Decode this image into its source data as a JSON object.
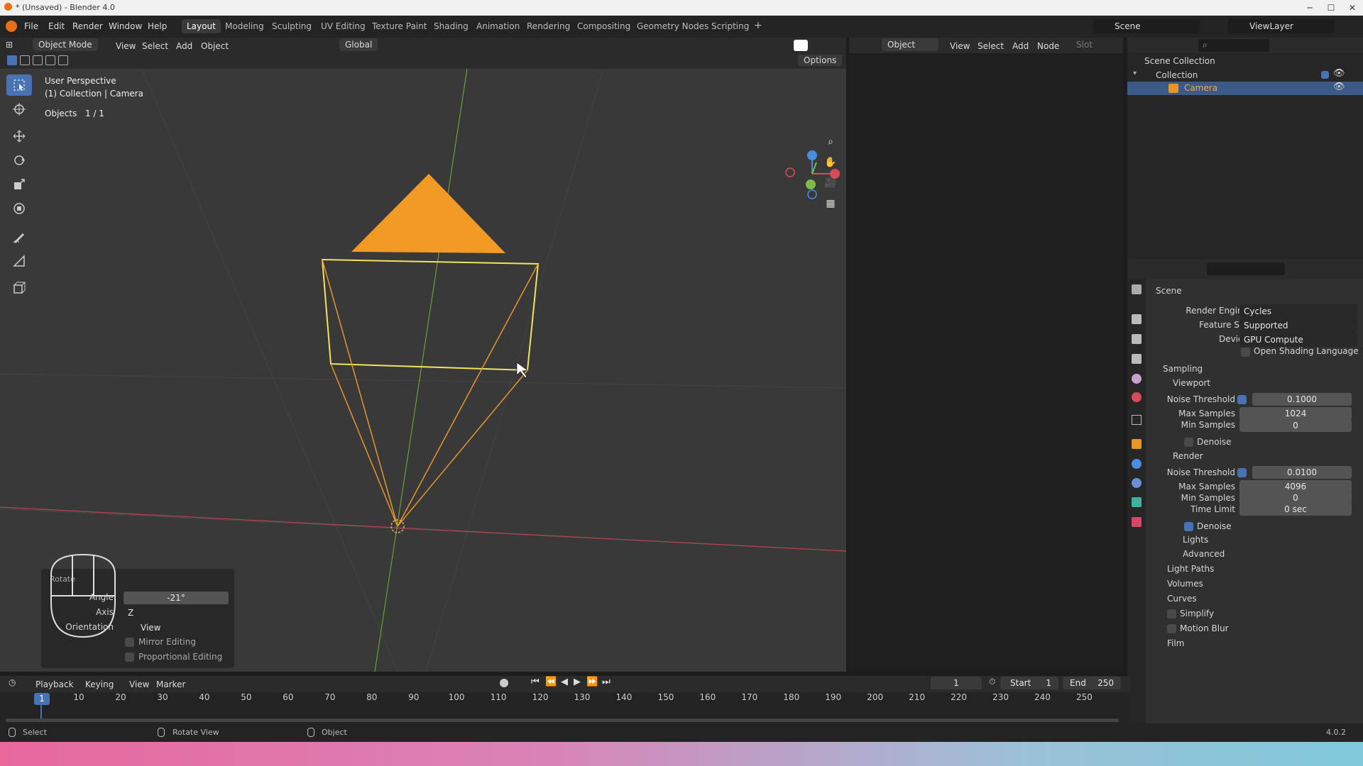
{
  "window": {
    "title": "* (Unsaved) - Blender 4.0"
  },
  "menus": [
    "File",
    "Edit",
    "Render",
    "Window",
    "Help"
  ],
  "workspaces": [
    "Layout",
    "Modeling",
    "Sculpting",
    "UV Editing",
    "Texture Paint",
    "Shading",
    "Animation",
    "Rendering",
    "Compositing",
    "Geometry Nodes",
    "Scripting"
  ],
  "active_workspace": "Layout",
  "scene": {
    "name": "Scene",
    "view_layer": "ViewLayer"
  },
  "viewport": {
    "mode": "Object Mode",
    "menus": [
      "View",
      "Select",
      "Add",
      "Object"
    ],
    "transform": "Global",
    "options": "Options",
    "overlay_title": "User Perspective",
    "overlay_collection": "(1) Collection | Camera",
    "objects_label": "Objects",
    "objects_count": "1 / 1",
    "colors": {
      "bg": "#393939",
      "camera_frame": "#f2e45a",
      "camera_lines": "#e8952a",
      "triangle": "#f19a25",
      "x_axis": "#b8434f",
      "y_axis": "#6f9e3a"
    }
  },
  "rotate_panel": {
    "title": "Rotate",
    "angle_label": "Angle",
    "angle_value": "-21°",
    "axis_label": "Axis",
    "axis_value": "Z",
    "orientation_label": "Orientation",
    "orientation_value": "View",
    "mirror": "Mirror Editing",
    "proportional": "Proportional Editing"
  },
  "node_editor": {
    "menus": [
      "View",
      "Select",
      "Add",
      "Node"
    ],
    "type": "Object",
    "slot": "Slot"
  },
  "outliner": {
    "root": "Scene Collection",
    "collection": "Collection",
    "camera": "Camera"
  },
  "properties": {
    "header": "Scene",
    "render_engine_label": "Render Engine",
    "render_engine": "Cycles",
    "feature_set_label": "Feature Set",
    "feature_set": "Supported",
    "device_label": "Device",
    "device": "GPU Compute",
    "osl": "Open Shading Language",
    "sampling": "Sampling",
    "viewport": "Viewport",
    "noise_threshold": "Noise Threshold",
    "vp_noise": "0.1000",
    "max_samples": "Max Samples",
    "vp_max": "1024",
    "min_samples": "Min Samples",
    "vp_min": "0",
    "denoise": "Denoise",
    "render": "Render",
    "r_noise": "0.0100",
    "r_max": "4096",
    "r_min": "0",
    "time_limit": "Time Limit",
    "r_time": "0 sec",
    "lights": "Lights",
    "advanced": "Advanced",
    "light_paths": "Light Paths",
    "volumes": "Volumes",
    "curves": "Curves",
    "simplify": "Simplify",
    "motion_blur": "Motion Blur",
    "film": "Film"
  },
  "timeline": {
    "menus": [
      "Playback",
      "Keying",
      "View",
      "Marker"
    ],
    "current": "1",
    "start_label": "Start",
    "start": "1",
    "end_label": "End",
    "end": "250",
    "ticks": [
      "1",
      "10",
      "20",
      "30",
      "40",
      "50",
      "60",
      "70",
      "80",
      "90",
      "100",
      "110",
      "120",
      "130",
      "140",
      "150",
      "160",
      "170",
      "180",
      "190",
      "200",
      "210",
      "220",
      "230",
      "240",
      "250"
    ]
  },
  "status": {
    "select": "Select",
    "rotate": "Rotate View",
    "object": "Object",
    "version": "4.0.2"
  }
}
